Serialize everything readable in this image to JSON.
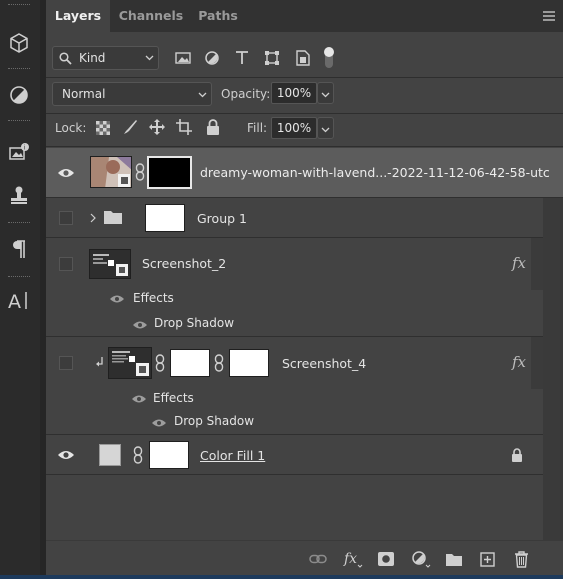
{
  "tabs": [
    {
      "label": "Layers",
      "active": true
    },
    {
      "label": "Channels",
      "active": false
    },
    {
      "label": "Paths",
      "active": false
    }
  ],
  "filter": {
    "kind_label": "Kind"
  },
  "blend": {
    "mode": "Normal",
    "opacity_label": "Opacity:",
    "opacity": "100%"
  },
  "lock": {
    "label": "Lock:",
    "fill_label": "Fill:",
    "fill": "100%"
  },
  "layers": [
    {
      "name": "dreamy-woman-with-lavend...-2022-11-12-06-42-58-utc",
      "visible": true,
      "selected": true
    },
    {
      "name": "Group 1",
      "visible": false,
      "type": "group"
    },
    {
      "name": "Screenshot_2",
      "visible": false,
      "fx": "fx",
      "effects_label": "Effects",
      "effect": "Drop Shadow"
    },
    {
      "name": "Screenshot_4",
      "visible": false,
      "fx": "fx",
      "effects_label": "Effects",
      "effect": "Drop Shadow",
      "clipped": true
    },
    {
      "name": "Color Fill 1",
      "visible": true,
      "locked": true
    }
  ],
  "colors": {
    "accent": "#1d3a5c",
    "panel_bg": "#434343",
    "selected_row": "#5c5c5c"
  }
}
